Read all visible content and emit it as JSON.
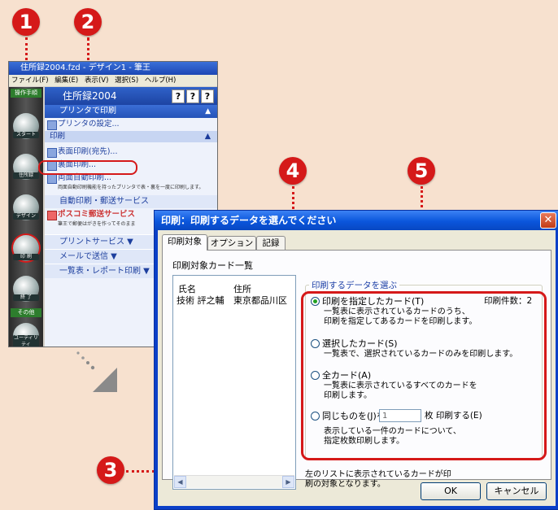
{
  "callouts": [
    "1",
    "2",
    "3",
    "4",
    "5"
  ],
  "app": {
    "title": "住所録2004.fzd - デザイン1 - 筆王",
    "menu": [
      "ファイル(F)",
      "編集(E)",
      "表示(V)",
      "選択(S)",
      "ヘルプ(H)"
    ],
    "panel_title": "住所録2004",
    "help_buttons": [
      "?",
      "?",
      "?"
    ],
    "left_tags": {
      "top": "操作手順",
      "other": "その他"
    },
    "left_buttons": [
      "スタート",
      "住所録",
      "デザイン",
      "印 刷",
      "終 了",
      "ユーティリティ"
    ],
    "section_print_title": "プリンタで印刷",
    "printer_setting": "プリンタの設定...",
    "print_sub": "印刷",
    "items": {
      "front_print": "表面印刷(宛先)...",
      "back_print": "裏面印刷...",
      "duplex_print": "両面自動印刷...",
      "duplex_note": "両面自動印刷機能を持ったプリンタで表・裏を一度に印刷します。"
    },
    "section_auto": "自動印刷・郵送サービス",
    "poscomi": "ポスコミ郵送サービス",
    "poscomi_note": "筆王で郵便はがきを作ってそのまま",
    "print_service": "プリントサービス",
    "mail_send": "メールで送信",
    "list_report": "一覧表・レポート印刷"
  },
  "dialog": {
    "title": "印刷：印刷するデータを選んでください",
    "close_glyph": "✕",
    "tabs": [
      "印刷対象",
      "オプション",
      "記録"
    ],
    "list_label": "印刷対象カード一覧",
    "list_columns": [
      "氏名",
      "住所"
    ],
    "list_rows": [
      [
        "技術 評之輔",
        "東京都品川区"
      ]
    ],
    "group_legend": "印刷するデータを選ぶ",
    "copies_label": "印刷件数：2",
    "options": [
      {
        "label": "印刷を指定したカード(T)",
        "desc": [
          "一覧表に表示されているカードのうち、",
          "印刷を指定してあるカードを印刷します。"
        ],
        "checked": true
      },
      {
        "label": "選択したカード(S)",
        "desc": [
          "一覧表で、選択されているカードのみを印刷します。"
        ],
        "checked": false
      },
      {
        "label": "全カード(A)",
        "desc": [
          "一覧表に表示されているすべてのカードを",
          "印刷します。"
        ],
        "checked": false
      },
      {
        "label": "同じものを(J)を",
        "desc": [
          "表示している一件のカードについて、",
          "指定枚数印刷します。"
        ],
        "checked": false
      }
    ],
    "copies_value": "1",
    "copies_suffix": "枚 印刷する(E)",
    "note": [
      "左のリストに表示されているカードが印",
      "刷の対象となります。"
    ],
    "ok": "OK",
    "cancel": "キャンセル"
  },
  "colors": {
    "accent": "#d51919",
    "background": "#f7e1cf",
    "titlebar": "#0a56dc"
  }
}
